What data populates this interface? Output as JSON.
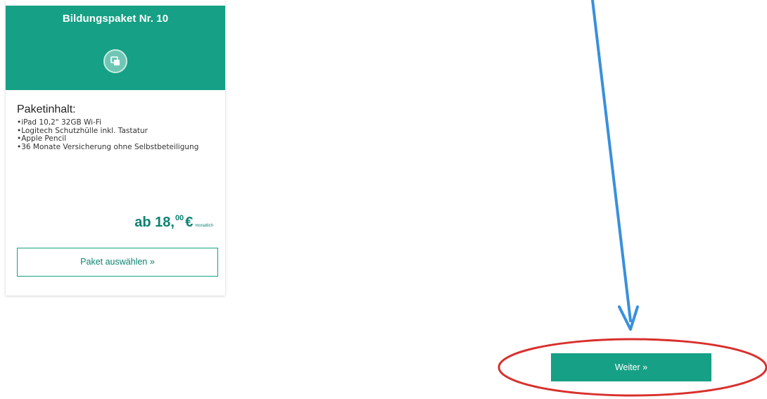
{
  "card": {
    "title": "Bildungspaket Nr. 10",
    "icon": "devices-icon",
    "content_heading": "Paketinhalt:",
    "content_items": [
      "iPad 10,2\" 32GB Wi-Fi",
      "Logitech Schutzhülle inkl. Tastatur",
      "Apple Pencil",
      "36 Monate Versicherung ohne Selbstbeteiligung"
    ],
    "price": {
      "prefix_amount": "ab 18,",
      "cents": "00",
      "currency": "€",
      "unit": "monatlich"
    },
    "select_button_label": "Paket auswählen »"
  },
  "next_button_label": "Weiter »",
  "colors": {
    "accent": "#16a085",
    "accent_dark": "#0e8272",
    "annotation_arrow": "#3a8fdc",
    "annotation_circle": "#d9302c"
  }
}
